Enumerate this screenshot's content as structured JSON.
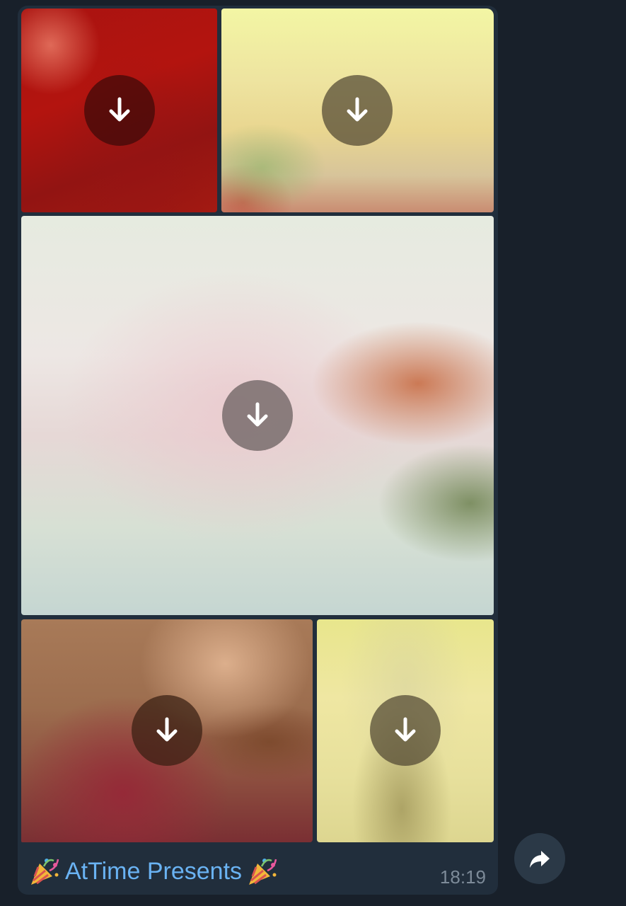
{
  "album": {
    "items": [
      {
        "name": "photo-1",
        "action_icon": "download-arrow-icon"
      },
      {
        "name": "photo-2",
        "action_icon": "download-arrow-icon"
      },
      {
        "name": "photo-3",
        "action_icon": "download-arrow-icon"
      },
      {
        "name": "photo-4",
        "action_icon": "download-arrow-icon"
      },
      {
        "name": "photo-5",
        "action_icon": "download-arrow-icon"
      }
    ]
  },
  "caption": {
    "leading_icon": "party-popper-icon",
    "text": "AtTime Presents",
    "trailing_icon": "party-popper-icon"
  },
  "message": {
    "time": "18:19"
  },
  "share_button": {
    "icon": "share-arrow-icon"
  },
  "colors": {
    "background": "#18202a",
    "bubble": "#212e3c",
    "caption_text": "#6ab3f3",
    "time_text": "#7d8b99"
  }
}
